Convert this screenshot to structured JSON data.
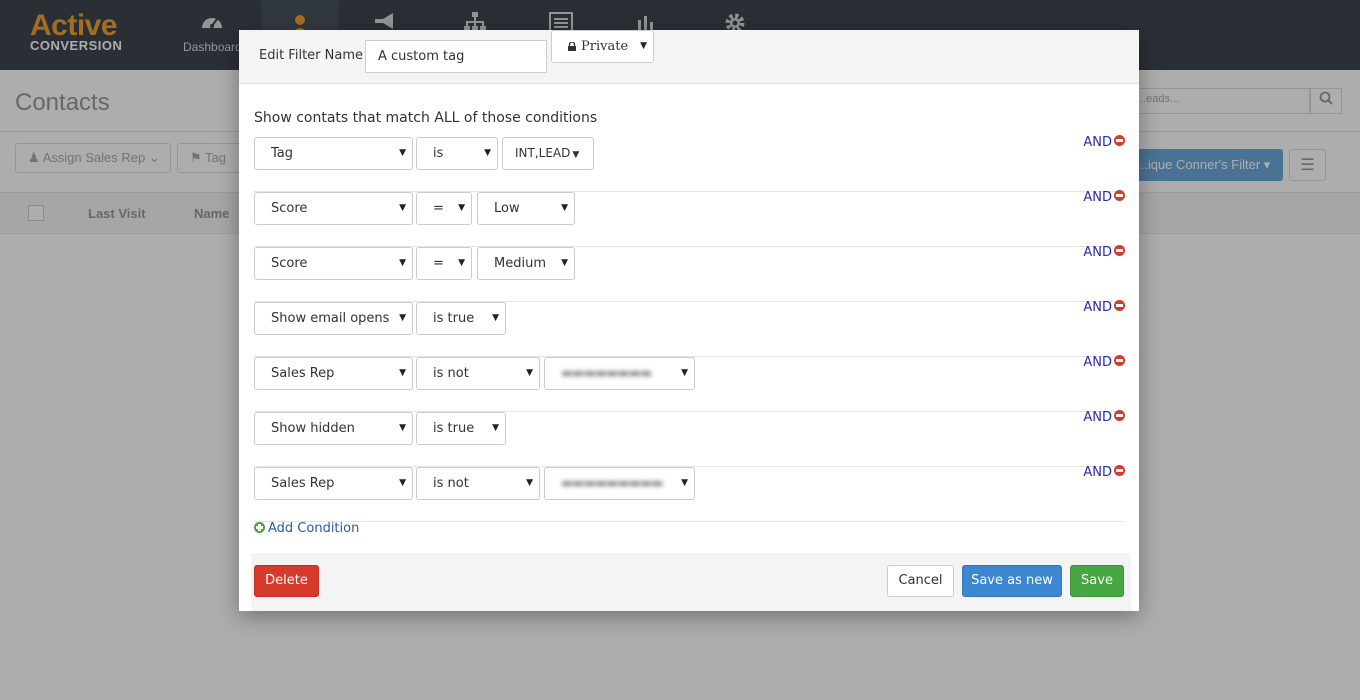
{
  "app": {
    "logo_top": "Active",
    "logo_bottom": "CONVERSION",
    "nav_dashboard_label": "Dashboard",
    "page_title": "Contacts",
    "search_placeholder": "...eads...",
    "assign_sales_rep_label": "Assign Sales Rep",
    "tag_label": "Tag",
    "filter_button_label": "...ique Conner's Filter",
    "columns": [
      "Last Visit",
      "Name"
    ]
  },
  "modal": {
    "header": {
      "label": "Edit Filter Name",
      "filter_name": "A custom tag",
      "privacy": "Private"
    },
    "intro_text": "Show contats that match ALL of those conditions",
    "conditions": [
      {
        "field": "Tag",
        "operator": "is",
        "value": "INT,LEAD",
        "join": "AND"
      },
      {
        "field": "Score",
        "operator": "=",
        "value": "Low",
        "join": "AND"
      },
      {
        "field": "Score",
        "operator": "=",
        "value": "Medium",
        "join": "AND"
      },
      {
        "field": "Show email opens",
        "operator": "is true",
        "value": "",
        "join": "AND"
      },
      {
        "field": "Sales Rep",
        "operator": "is not",
        "value": "redacted",
        "join": "AND"
      },
      {
        "field": "Show hidden",
        "operator": "is true",
        "value": "",
        "join": "AND"
      },
      {
        "field": "Sales Rep",
        "operator": "is not",
        "value": "redacted",
        "join": "AND"
      }
    ],
    "add_condition_label": "Add Condition",
    "buttons": {
      "delete": "Delete",
      "cancel": "Cancel",
      "save_as_new": "Save as new",
      "save": "Save"
    }
  },
  "colors": {
    "delete": "#d63a2a",
    "save_as_new": "#3d87d0",
    "save": "#46a642",
    "and_link": "#2a2aa8"
  }
}
